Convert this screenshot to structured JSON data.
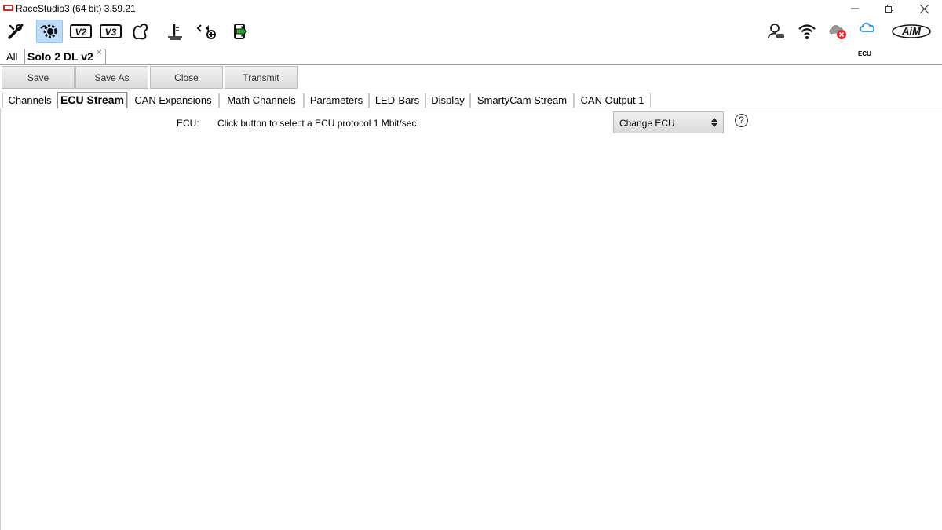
{
  "window": {
    "title": "RaceStudio3 (64 bit) 3.59.21"
  },
  "toolbar": {
    "tools": [
      {
        "icon": "wrench-icon"
      },
      {
        "icon": "config-gear-icon",
        "active": true
      },
      {
        "icon": "v2-icon"
      },
      {
        "icon": "v3-icon"
      },
      {
        "icon": "track-icon"
      },
      {
        "icon": "sensor-icon"
      },
      {
        "icon": "device-add-icon"
      },
      {
        "icon": "transmit-arrow-icon"
      }
    ],
    "right_icons": [
      "user-status-icon",
      "wifi-icon",
      "cloud-error-icon",
      "ecu-cloud-icon",
      "aim-logo"
    ],
    "ecu_label": "ECU",
    "aim_logo": "AiM"
  },
  "doc_tabs": {
    "all_label": "All",
    "active_label": "Solo 2 DL v2"
  },
  "actions": {
    "save": "Save",
    "save_as": "Save As",
    "close": "Close",
    "transmit": "Transmit"
  },
  "config_tabs": [
    {
      "label": "Channels"
    },
    {
      "label": "ECU Stream",
      "active": true
    },
    {
      "label": "CAN Expansions"
    },
    {
      "label": "Math Channels"
    },
    {
      "label": "Parameters"
    },
    {
      "label": "LED-Bars"
    },
    {
      "label": "Display"
    },
    {
      "label": "SmartyCam Stream"
    },
    {
      "label": "CAN Output 1"
    }
  ],
  "ecu": {
    "label": "ECU:",
    "description": "Click button to select a ECU protocol 1 Mbit/sec",
    "button_label": "Change ECU",
    "help": "?"
  },
  "colors": {
    "active_tool_bg": "#bcdcf7",
    "transmit_green": "#2ea12e",
    "error_red": "#e0262b",
    "ecu_cloud_blue": "#2a8fd8"
  }
}
